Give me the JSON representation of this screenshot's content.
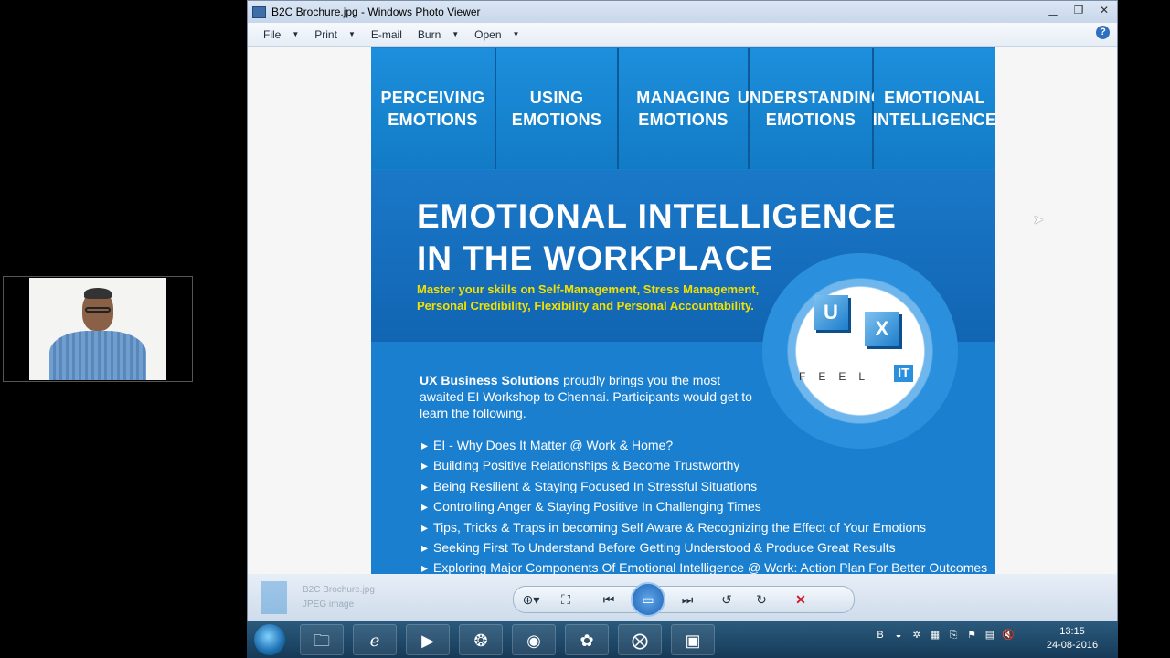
{
  "window": {
    "title": "B2C Brochure.jpg - Windows Photo Viewer",
    "menu": [
      "File",
      "Print",
      "E-mail",
      "Burn",
      "Open"
    ],
    "menu_has_caret": [
      true,
      true,
      false,
      true,
      true
    ]
  },
  "brochure": {
    "tabs": [
      "PERCEIVING EMOTIONS",
      "USING EMOTIONS",
      "MANAGING EMOTIONS",
      "UNDERSTANDING EMOTIONS",
      "EMOTIONAL INTELLIGENCE"
    ],
    "title_line1": "EMOTIONAL INTELLIGENCE",
    "title_line2": "IN THE WORKPLACE",
    "subtitle": "Master your skills on Self-Management, Stress Management, Personal Credibility, Flexibility and Personal Accountability.",
    "intro_brand": "UX Business Solutions",
    "intro_text": " proudly brings you the most awaited EI Workshop to Chennai. Participants would get to learn the following.",
    "bullets": [
      "EI - Why Does It Matter @ Work & Home?",
      "Building Positive Relationships & Become Trustworthy",
      "Being Resilient & Staying Focused In Stressful Situations",
      "Controlling Anger & Staying Positive In Challenging Times",
      "Tips, Tricks & Traps in becoming Self Aware & Recognizing the Effect of Your Emotions",
      "Seeking First To Understand Before Getting Understood &  Produce Great Results",
      "Exploring Major Components Of Emotional Intelligence @ Work: Action Plan For Better Outcomes"
    ],
    "logo": {
      "cube1": "U",
      "cube2": "X",
      "feel": "FEEL",
      "it": "IT"
    },
    "colors": {
      "accent": "#1b7fcf",
      "subtitle": "#f2e100"
    }
  },
  "bottombar": {
    "file_name": "B2C Brochure.jpg",
    "file_type": "JPEG image"
  },
  "taskbar": {
    "time": "13:15",
    "date": "24-08-2016"
  }
}
